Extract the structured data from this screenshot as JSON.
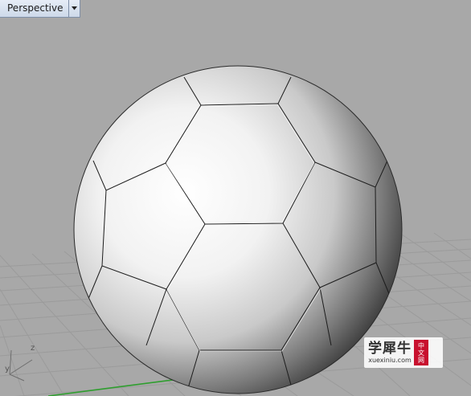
{
  "viewport": {
    "name": "Perspective",
    "background_color": "#a8a8a8",
    "grid_color": "#9a9a9a",
    "x_axis_color": "#2e9e2e",
    "object": "soccer-ball"
  },
  "axes": {
    "x_label": "",
    "y_label": "y",
    "z_label": "z"
  },
  "watermark": {
    "main_text": "学犀牛",
    "url": "xuexiniu.com",
    "seal_chars": [
      "中",
      "文",
      "网"
    ]
  },
  "icons": {
    "dropdown": "caret-down-icon"
  }
}
